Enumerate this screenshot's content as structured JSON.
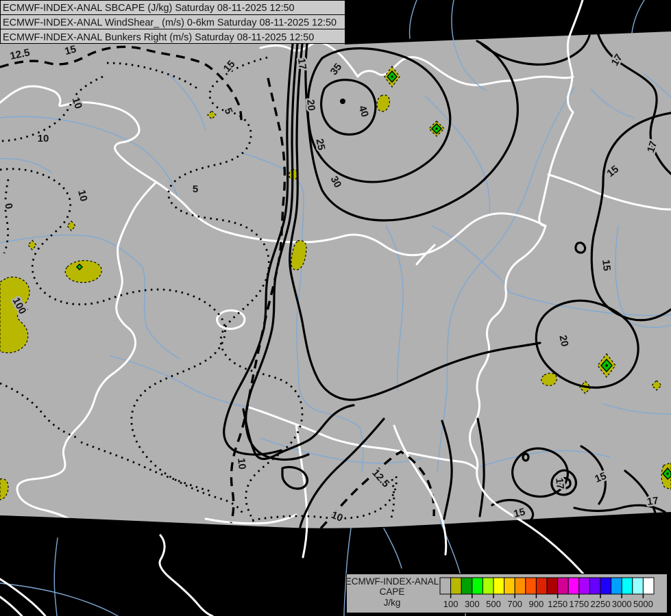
{
  "header": {
    "lines": [
      "ECMWF-INDEX-ANAL SBCAPE (J/kg) Saturday 08-11-2025 12:50",
      "ECMWF-INDEX-ANAL WindShear_ (m/s) 0-6km Saturday 08-11-2025 12:50",
      "ECMWF-INDEX-ANAL Bunkers Right (m/s) Saturday 08-11-2025 12:50"
    ]
  },
  "legend": {
    "title_lines": [
      "ECMWF-INDEX-ANAL",
      "CAPE",
      "J/kg"
    ],
    "tick_labels": [
      "100",
      "300",
      "500",
      "700",
      "900",
      "1250",
      "1750",
      "2250",
      "3000",
      "5000"
    ],
    "cell_colors": [
      "#b1b1b1",
      "#b8b800",
      "#00a000",
      "#00ff00",
      "#aaff00",
      "#ffff00",
      "#ffc800",
      "#ff9100",
      "#ff5500",
      "#dd2200",
      "#aa0000",
      "#d40096",
      "#ff00ff",
      "#aa00ff",
      "#6600ff",
      "#1e00ff",
      "#00a0ff",
      "#00ffff",
      "#99ffff",
      "#ffffff"
    ]
  },
  "map": {
    "colors": {
      "land_gray": "#b1b1b1",
      "out_of_domain": "#000000",
      "river_blue": "#7fa9d4",
      "border_white": "#ffffff",
      "cape_patch_yellow": "#b8b800",
      "marker_green": "#00c400",
      "contour_black": "#000000"
    },
    "contour_labels": [
      {
        "text": "12.5"
      },
      {
        "text": "15"
      },
      {
        "text": "15"
      },
      {
        "text": "17"
      },
      {
        "text": "20"
      },
      {
        "text": "25"
      },
      {
        "text": "30"
      },
      {
        "text": "35"
      },
      {
        "text": "40"
      },
      {
        "text": "17"
      },
      {
        "text": "17"
      },
      {
        "text": "15"
      },
      {
        "text": "15"
      },
      {
        "text": "20"
      },
      {
        "text": "15"
      },
      {
        "text": "17"
      },
      {
        "text": "15"
      },
      {
        "text": "17"
      },
      {
        "text": "10"
      },
      {
        "text": "10"
      },
      {
        "text": "5"
      },
      {
        "text": "5"
      },
      {
        "text": "10"
      },
      {
        "text": "0"
      },
      {
        "text": "100"
      },
      {
        "text": "10"
      },
      {
        "text": "12.5"
      },
      {
        "text": "10"
      }
    ]
  }
}
